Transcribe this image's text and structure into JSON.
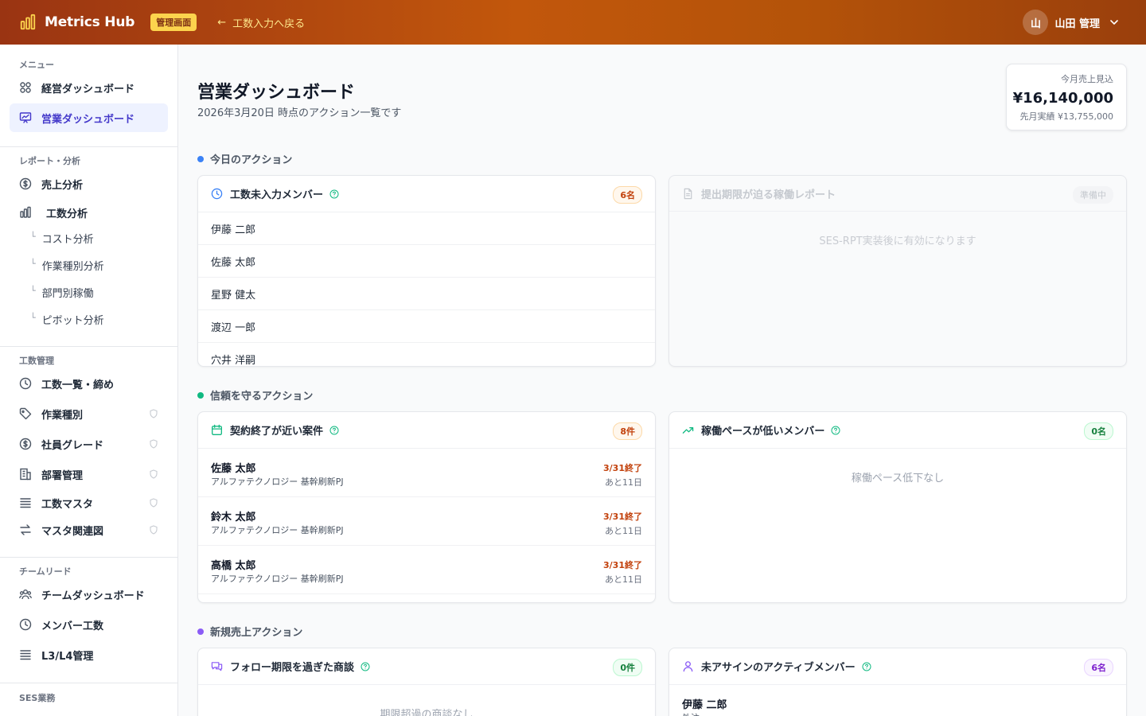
{
  "header": {
    "app_name": "Metrics Hub",
    "admin_badge": "管理画面",
    "back_link": "工数入力へ戻る",
    "user_initial": "山",
    "user_name": "山田 管理"
  },
  "sidebar": {
    "sections": {
      "menu": "メニュー",
      "reports": "レポート・分析",
      "effort_mgmt": "工数管理",
      "team_lead": "チームリード",
      "ses": "SES業務"
    },
    "items": {
      "exec_dashboard": "経営ダッシュボード",
      "sales_dashboard": "営業ダッシュボード",
      "sales_analysis": "売上分析",
      "effort_analysis": "工数分析",
      "cost_analysis": "コスト分析",
      "work_type_analysis": "作業種別分析",
      "dept_utilization": "部門別稼働",
      "pivot_analysis": "ピボット分析",
      "effort_list": "工数一覧・締め",
      "work_types": "作業種別",
      "employee_grades": "社員グレード",
      "dept_mgmt": "部署管理",
      "effort_master": "工数マスタ",
      "master_diagram": "マスタ関連図",
      "team_dashboard": "チームダッシュボード",
      "member_effort": "メンバー工数",
      "l3l4_mgmt": "L3/L4管理"
    }
  },
  "page": {
    "title": "営業ダッシュボード",
    "subtitle": "2026年3月20日 時点のアクション一覧です"
  },
  "kpi": {
    "label": "今月売上見込",
    "value": "¥16,140,000",
    "sub": "先月実績 ¥13,755,000"
  },
  "sections": {
    "today": "今日のアクション",
    "trust": "信頼を守るアクション",
    "new_sales": "新規売上アクション"
  },
  "colors": {
    "today_dot": "#3b82f6",
    "trust_dot": "#10b981",
    "new_sales_dot": "#8b5cf6"
  },
  "cards": {
    "missing_effort": {
      "title": "工数未入力メンバー",
      "badge": "6名",
      "members": [
        "伊藤 二郎",
        "佐藤 太郎",
        "星野 健太",
        "渡辺 一郎",
        "穴井 洋嗣"
      ]
    },
    "report_deadline": {
      "title": "提出期限が迫る稼働レポート",
      "badge": "準備中",
      "empty": "SES-RPT実装後に有効になります"
    },
    "contract_ending": {
      "title": "契約終了が近い案件",
      "badge": "8件",
      "rows": [
        {
          "name": "佐藤 太郎",
          "project": "アルファテクノロジー 基幹刷新PJ",
          "end": "3/31終了",
          "remaining": "あと11日"
        },
        {
          "name": "鈴木 太郎",
          "project": "アルファテクノロジー 基幹刷新PJ",
          "end": "3/31終了",
          "remaining": "あと11日"
        },
        {
          "name": "高橋 太郎",
          "project": "アルファテクノロジー 基幹刷新PJ",
          "end": "3/31終了",
          "remaining": "あと11日"
        }
      ]
    },
    "low_pace": {
      "title": "稼働ペースが低いメンバー",
      "badge": "0名",
      "empty": "稼働ペース低下なし"
    },
    "overdue_followup": {
      "title": "フォロー期限を過ぎた商談",
      "badge": "0件",
      "empty": "期限超過の商談なし"
    },
    "unassigned": {
      "title": "未アサインのアクティブメンバー",
      "badge": "6名",
      "first_name": "伊藤 二郎",
      "first_sub": "外注"
    }
  }
}
